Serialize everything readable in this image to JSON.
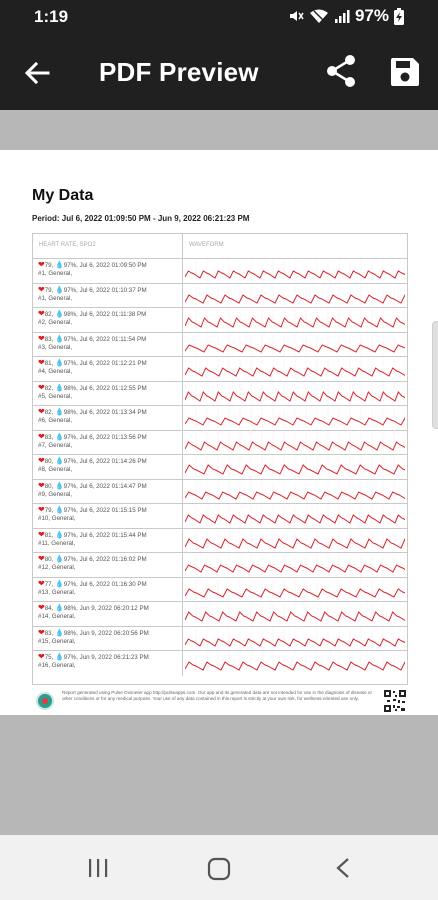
{
  "status": {
    "time": "1:19",
    "battery": "97%"
  },
  "appbar": {
    "title": "PDF Preview"
  },
  "doc": {
    "title": "My Data",
    "period": "Period: Jul 6, 2022 01:09:50 PM - Jun 9, 2022 06:21:23 PM",
    "col_left": "HEART RATE, SPO2",
    "col_right": "WAVEFORM",
    "footer_note": "Report generated using Pulse Oximeter app http://pulseapps.com. Our app and its generated data are not intended for use in the diagnosis of disease or other conditions or for any medical purpose. Your use of any data contained in this report is strictly at your own risk, for wellness-oriented use only.",
    "rows": [
      {
        "hr": "79",
        "spo2": "97%",
        "date": "Jul 6, 2022 01:09:50 PM",
        "tag": "#1, General,"
      },
      {
        "hr": "79",
        "spo2": "97%",
        "date": "Jul 6, 2022 01:10:37 PM",
        "tag": "#1, General,"
      },
      {
        "hr": "82",
        "spo2": "98%",
        "date": "Jul 6, 2022 01:11:38 PM",
        "tag": "#2, General,"
      },
      {
        "hr": "83",
        "spo2": "97%",
        "date": "Jul 6, 2022 01:11:54 PM",
        "tag": "#3, General,"
      },
      {
        "hr": "81",
        "spo2": "97%",
        "date": "Jul 6, 2022 01:12:21 PM",
        "tag": "#4, General,"
      },
      {
        "hr": "82",
        "spo2": "98%",
        "date": "Jul 6, 2022 01:12:55 PM",
        "tag": "#5, General,"
      },
      {
        "hr": "82",
        "spo2": "98%",
        "date": "Jul 6, 2022 01:13:34 PM",
        "tag": "#6, General,"
      },
      {
        "hr": "83",
        "spo2": "97%",
        "date": "Jul 6, 2022 01:13:56 PM",
        "tag": "#7, General,"
      },
      {
        "hr": "80",
        "spo2": "97%",
        "date": "Jul 6, 2022 01:14:26 PM",
        "tag": "#8, General,"
      },
      {
        "hr": "80",
        "spo2": "97%",
        "date": "Jul 6, 2022 01:14:47 PM",
        "tag": "#9, General,"
      },
      {
        "hr": "79",
        "spo2": "97%",
        "date": "Jul 6, 2022 01:15:15 PM",
        "tag": "#10, General,"
      },
      {
        "hr": "81",
        "spo2": "97%",
        "date": "Jul 6, 2022 01:15:44 PM",
        "tag": "#11, General,"
      },
      {
        "hr": "80",
        "spo2": "97%",
        "date": "Jul 6, 2022 01:16:02 PM",
        "tag": "#12, General,"
      },
      {
        "hr": "77",
        "spo2": "97%",
        "date": "Jul 6, 2022 01:16:30 PM",
        "tag": "#13, General,"
      },
      {
        "hr": "84",
        "spo2": "98%",
        "date": "Jun 9, 2022 06:20:12 PM",
        "tag": "#14, General,"
      },
      {
        "hr": "83",
        "spo2": "98%",
        "date": "Jun 9, 2022 06:20:56 PM",
        "tag": "#15, General,"
      },
      {
        "hr": "75",
        "spo2": "97%",
        "date": "Jun 9, 2022 06:21:23 PM",
        "tag": "#16, General,"
      }
    ]
  },
  "icons": {
    "back": "arrow-left-icon",
    "share": "share-icon",
    "save": "floppy-disk-icon",
    "heart": "heart-icon",
    "drop": "droplet-icon"
  },
  "colors": {
    "appbar": "#202020",
    "waveform": "#d8262c",
    "heart": "#e11c1c",
    "drop": "#3b8fe2",
    "viewer_bg": "#b7b7b7"
  }
}
